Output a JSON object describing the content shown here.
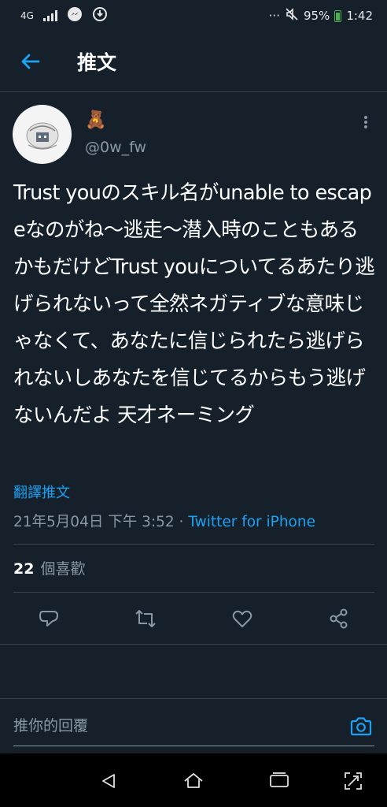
{
  "status_bar": {
    "network": "4G",
    "battery": "95%",
    "time": "1:42",
    "more": "···"
  },
  "header": {
    "title": "推文"
  },
  "tweet": {
    "display_name_emoji": "🧸",
    "handle": "@0w_fw",
    "text": "Trust youのスキル名がunable to escapeなのがね〜逃走〜潜入時のこともあるかもだけどTrust youについてるあたり逃げられないって全然ネガティブな意味じゃなくて、あなたに信じられたら逃げられないしあなたを信じてるからもう逃げないんだよ 天才ネーミング",
    "translate_label": "翻譯推文",
    "timestamp": "21年5月04日 下午 3:52",
    "separator": " · ",
    "source": "Twitter for iPhone",
    "likes_count": "22",
    "likes_label": "個喜歡"
  },
  "reply": {
    "placeholder": "推你的回覆"
  },
  "colors": {
    "background": "#15202b",
    "accent": "#1da1f2",
    "secondary_text": "#8899a6",
    "divider": "#38444d"
  },
  "icons": {
    "back": "arrow-left-icon",
    "more": "vertical-dots-icon",
    "reply": "comment-icon",
    "retweet": "retweet-icon",
    "like": "heart-icon",
    "share": "share-icon",
    "camera": "camera-icon",
    "nav_back": "triangle-back-icon",
    "nav_home": "home-icon",
    "nav_recents": "recents-icon",
    "nav_screenshot": "screenshot-icon"
  }
}
